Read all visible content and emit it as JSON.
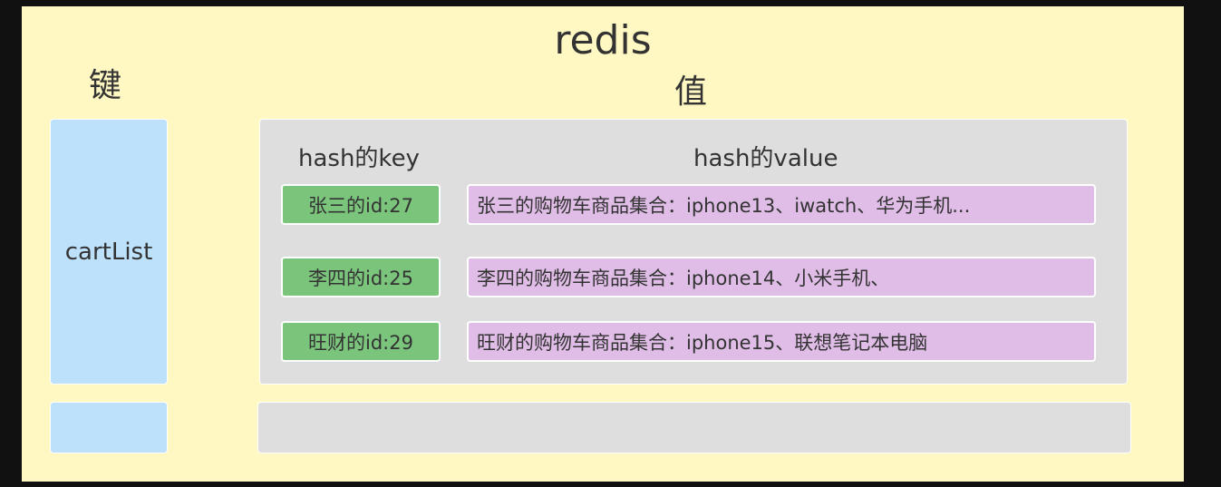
{
  "title": "redis",
  "key_header": "键",
  "value_header": "值",
  "key_name": "cartList",
  "hash_key_header": "hash的key",
  "hash_value_header": "hash的value",
  "entries": [
    {
      "key": "张三的id:27",
      "value": "张三的购物车商品集合：iphone13、iwatch、华为手机..."
    },
    {
      "key": "李四的id:25",
      "value": "李四的购物车商品集合：iphone14、小米手机、"
    },
    {
      "key": "旺财的id:29",
      "value": "旺财的购物车商品集合：iphone15、联想笔记本电脑"
    }
  ],
  "colors": {
    "background": "#fff8c2",
    "key_box": "#bde0fb",
    "value_box": "#dedede",
    "hash_key": "#7bc47c",
    "hash_value": "#e0bde7"
  }
}
